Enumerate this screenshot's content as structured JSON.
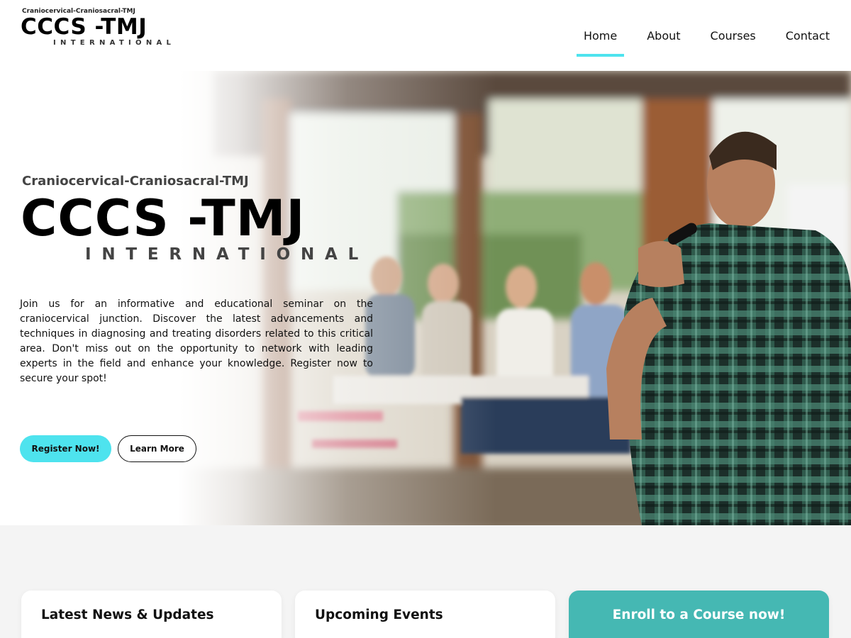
{
  "brand": {
    "small": "Craniocervical-Craniosacral-TMJ",
    "big": "CCCS -TMJ",
    "intl": "INTERNATIONAL"
  },
  "nav": {
    "items": [
      {
        "label": "Home",
        "active": true
      },
      {
        "label": "About",
        "active": false
      },
      {
        "label": "Courses",
        "active": false
      },
      {
        "label": "Contact",
        "active": false
      }
    ]
  },
  "hero": {
    "small": "Craniocervical-Craniosacral-TMJ",
    "big": "CCCS -TMJ",
    "intl": "INTERNATIONAL",
    "description": "Join us for an informative and educational seminar on the craniocervical junction. Discover the latest advancements and techniques in diagnosing and treating disorders related to this critical area. Don't miss out on the opportunity to network with leading experts in the field and enhance your knowledge. Register now to secure your spot!",
    "primary_button": "Register Now!",
    "secondary_button": "Learn More"
  },
  "cards": [
    {
      "title": "Latest News & Updates"
    },
    {
      "title": "Upcoming Events"
    },
    {
      "title": "Enroll to a Course now!"
    }
  ],
  "colors": {
    "accent": "#4ee3ee",
    "enroll_card": "#45b8b3",
    "section_bg": "#f4f4f4"
  }
}
